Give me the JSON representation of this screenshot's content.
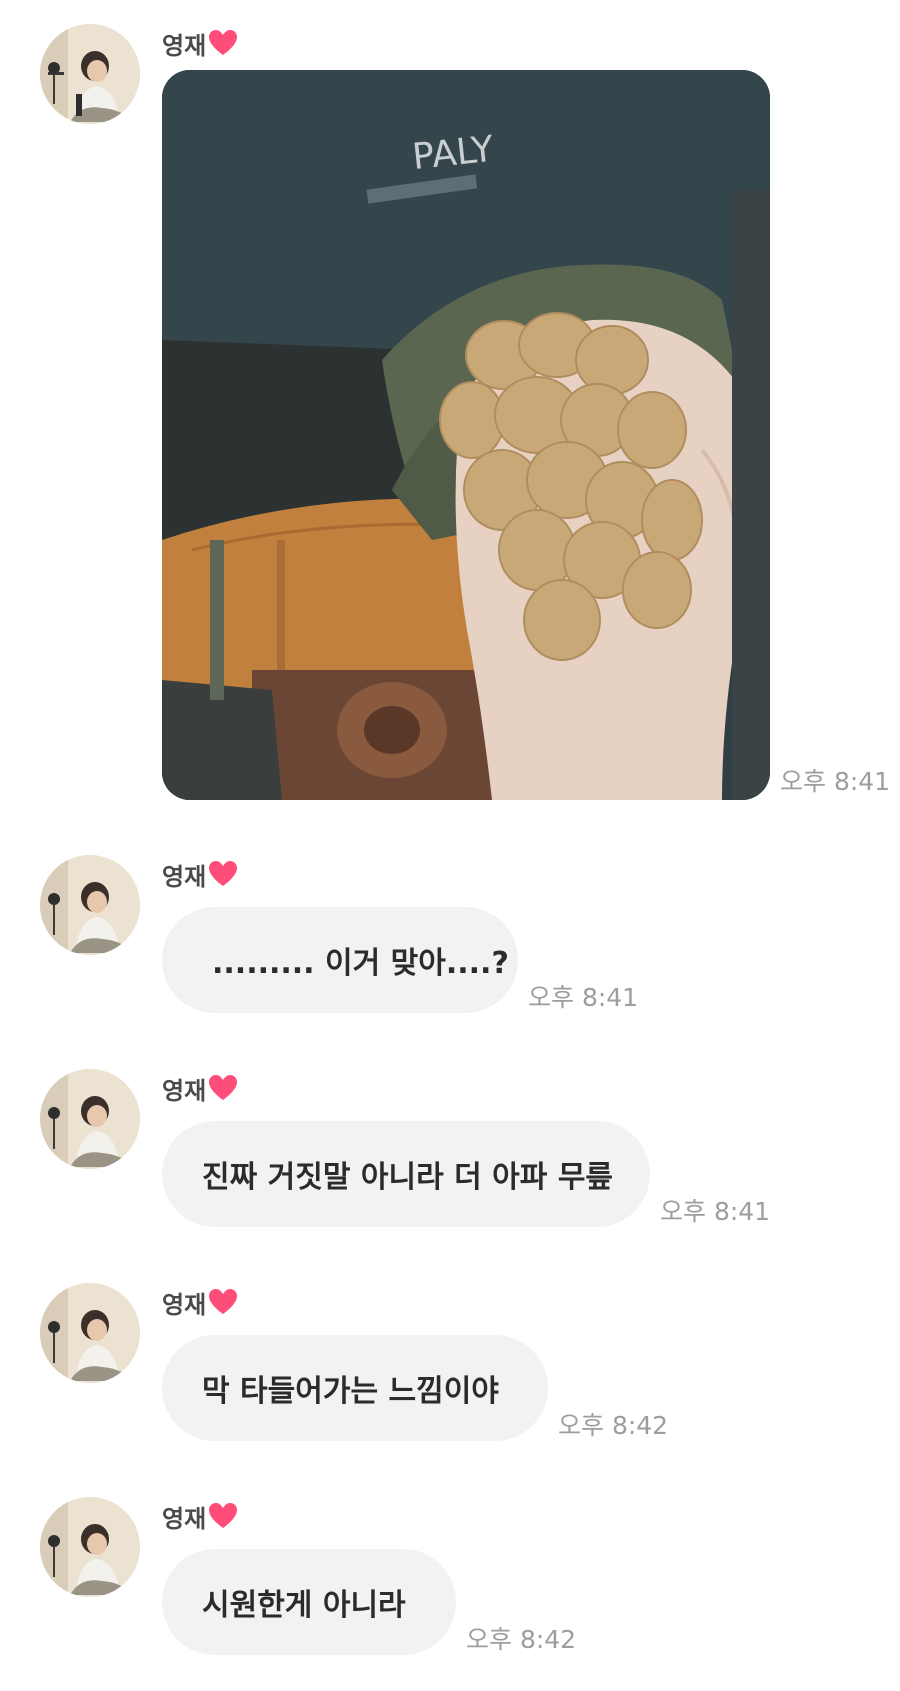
{
  "chat": {
    "messages": [
      {
        "sender": "영재",
        "type": "image",
        "time": "오후 8:41"
      },
      {
        "sender": "영재",
        "type": "text",
        "text": "......... 이거 맞아....?",
        "time": "오후 8:41"
      },
      {
        "sender": "영재",
        "type": "text",
        "text": "진짜 거짓말 아니라 더 아파 무릎",
        "time": "오후 8:41"
      },
      {
        "sender": "영재",
        "type": "text",
        "text": "막 타들어가는 느낌이야",
        "time": "오후 8:42"
      },
      {
        "sender": "영재",
        "type": "text",
        "text": "시원한게 아니라",
        "time": "오후 8:42"
      }
    ],
    "photo_shirt_text": "PALY",
    "heart_color": "#ff4d7a",
    "bubble_color": "#f2f2f4",
    "time_color": "#9d9d9d"
  }
}
